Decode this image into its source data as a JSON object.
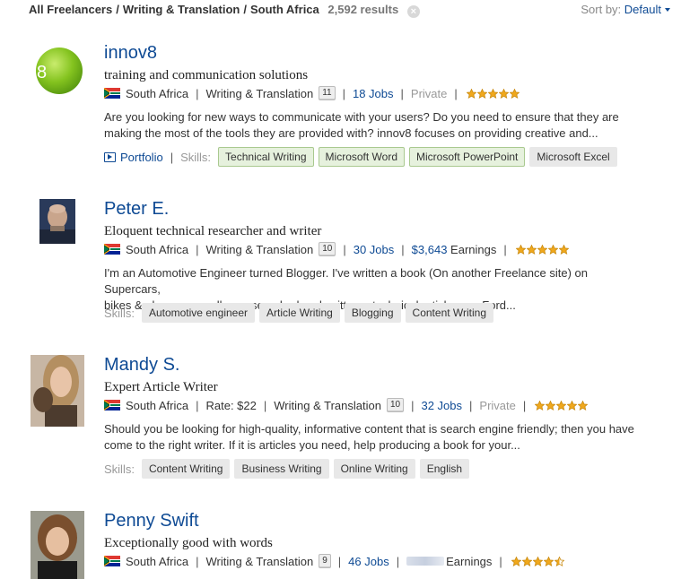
{
  "breadcrumb": {
    "items": [
      "All Freelancers",
      "Writing & Translation",
      "South Africa"
    ],
    "separator": "/",
    "results": "2,592 results"
  },
  "sort": {
    "label": "Sort by:",
    "value": "Default"
  },
  "skills_label": "Skills:",
  "listings": [
    {
      "name": "innov8",
      "tagline": "training and communication solutions",
      "country": "South Africa",
      "category": "Writing & Translation",
      "category_count": "11",
      "jobs": "18 Jobs",
      "status": "Private",
      "rating_stars": 5,
      "description_line1": "Are you looking for new ways to communicate with your users? Do you need to ensure that they are",
      "description_line2": "making the most of the tools they are provided with? innov8 focuses on providing creative and...",
      "portfolio": "Portfolio",
      "skills": [
        "Technical Writing",
        "Microsoft Word",
        "Microsoft PowerPoint",
        "Microsoft Excel"
      ]
    },
    {
      "name": "Peter E.",
      "tagline": "Eloquent technical researcher and writer",
      "country": "South Africa",
      "category": "Writing & Translation",
      "category_count": "10",
      "jobs": "30 Jobs",
      "earnings_amount": "$3,643",
      "earnings_label": "Earnings",
      "rating_stars": 5,
      "description_line1": "I'm an Automotive Engineer turned Blogger. I've written a book (On another Freelance site) on Supercars,",
      "description_line2": "bikes & planes; as well as researched and written a technical article on a Ford...",
      "skills": [
        "Automotive engineer",
        "Article Writing",
        "Blogging",
        "Content Writing"
      ]
    },
    {
      "name": "Mandy S.",
      "tagline": "Expert Article Writer",
      "country": "South Africa",
      "rate": "Rate: $22",
      "category": "Writing & Translation",
      "category_count": "10",
      "jobs": "32 Jobs",
      "status": "Private",
      "rating_stars": 5,
      "description_line1": "Should you be looking for high-quality, informative content that is search engine friendly; then you have",
      "description_line2": "come to the right writer. If it is articles you need, help producing a book for your...",
      "skills": [
        "Content Writing",
        "Business Writing",
        "Online Writing",
        "English"
      ]
    },
    {
      "name": "Penny Swift",
      "tagline": "Exceptionally good with words",
      "country": "South Africa",
      "category": "Writing & Translation",
      "category_count": "9",
      "jobs": "46 Jobs",
      "earnings_label": "Earnings",
      "rating_stars": 4.5
    }
  ],
  "colors": {
    "link": "#0e4a94",
    "star": "#f0a81c",
    "tag_highlight": "#e6f1dd"
  }
}
